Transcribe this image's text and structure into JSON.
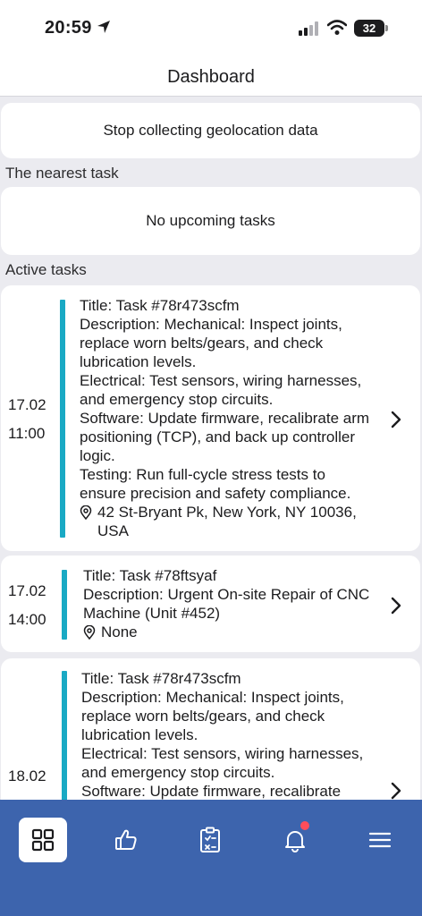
{
  "status_bar": {
    "time": "20:59",
    "battery": "32",
    "icons": [
      "location-arrow-icon",
      "cellular-signal-icon",
      "wifi-icon",
      "battery-icon"
    ]
  },
  "nav": {
    "title": "Dashboard"
  },
  "geolocation": {
    "button_label": "Stop collecting geolocation data"
  },
  "nearest": {
    "section_label": "The nearest task",
    "empty_text": "No upcoming tasks"
  },
  "active": {
    "section_label": "Active tasks",
    "tasks": [
      {
        "date": "17.02",
        "time": "11:00",
        "title": "Title: Task #78r473scfm",
        "description": "Description: Mechanical: Inspect joints, replace worn belts/gears, and check lubrication levels.",
        "electrical": "Electrical: Test sensors, wiring harnesses, and emergency stop circuits.",
        "software": "Software: Update firmware, recalibrate arm positioning (TCP), and back up controller logic.",
        "testing": "Testing: Run full-cycle stress tests to ensure precision and safety compliance.",
        "location": "42 St-Bryant Pk, New York, NY 10036, USA"
      },
      {
        "date": "17.02",
        "time": "14:00",
        "title": "Title: Task #78ftsyaf",
        "description": "Description: Urgent On-site Repair of CNC Machine (Unit #452)",
        "location": "None"
      },
      {
        "date": "18.02",
        "title": "Title: Task #78r473scfm",
        "description": "Description: Mechanical: Inspect joints, replace worn belts/gears, and check lubrication levels.",
        "electrical": "Electrical: Test sensors, wiring harnesses, and emergency stop circuits.",
        "software": "Software: Update firmware, recalibrate"
      }
    ]
  },
  "tab_bar": {
    "tabs": [
      {
        "icon": "dashboard-grid-icon",
        "active": true
      },
      {
        "icon": "thumbs-up-icon",
        "active": false
      },
      {
        "icon": "clipboard-checklist-icon",
        "active": false
      },
      {
        "icon": "bell-icon",
        "active": false,
        "badge": true
      },
      {
        "icon": "hamburger-menu-icon",
        "active": false
      }
    ]
  },
  "colors": {
    "accent_bar": "#19a9c4",
    "tab_bar_bg": "#3d64ad",
    "badge": "#ff4d5a",
    "background": "#ebebf0"
  }
}
